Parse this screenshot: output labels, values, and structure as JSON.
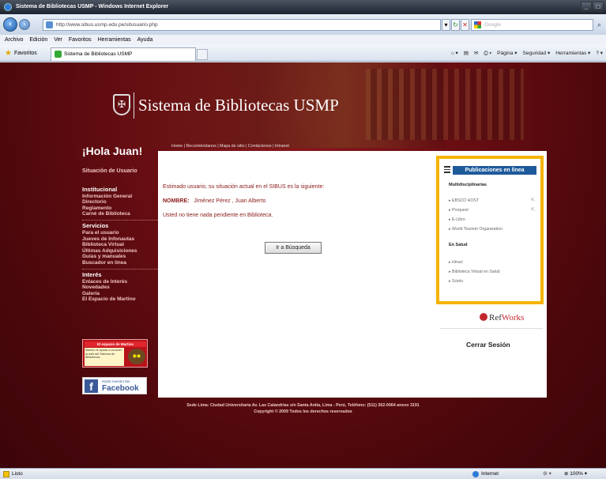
{
  "browser": {
    "window_title": "Sistema de Bibliotecas USMP - Windows Internet Explorer",
    "address": "http://www.sibus.usmp.edu.pe/situsuario.php",
    "search_placeholder": "Google",
    "menu": [
      "Archivo",
      "Edición",
      "Ver",
      "Favoritos",
      "Herramientas",
      "Ayuda"
    ],
    "favorites_label": "Favoritos",
    "tab_title": "Sistema de Bibliotecas USMP",
    "commands": [
      "Página",
      "Seguridad",
      "Herramientas"
    ],
    "status_text": "Listo",
    "zone": "Internet",
    "zoom": "100%"
  },
  "site": {
    "brand": "Sistema de Bibliotecas USMP",
    "greeting": "¡Hola Juan!",
    "top_nav": "Home  |  Recomiéndanos  |  Mapa de sitio  |  Contáctenos  |  Intranet"
  },
  "sidebar": {
    "situacion": "Situación de Usuario",
    "institucional": {
      "heading": "Institucional",
      "items": [
        "Información General",
        "Directorio",
        "Reglamento",
        "Carné de Biblioteca"
      ]
    },
    "servicios": {
      "heading": "Servicios",
      "items": [
        "Para el usuario",
        "Jueves de Infonautas",
        "Biblioteca Virtual",
        "Últimas Adquisiciones",
        "Guías y manuales",
        "Buscador en línea"
      ]
    },
    "interes": {
      "heading": "Interés",
      "items": [
        "Enlaces de Interés",
        "Novedades",
        "Galería",
        "El Espacio de Martino"
      ]
    },
    "martino": {
      "title": "El espacio de Martino",
      "body": "Martino te ayuda a conocer la web del Sistema de Bibliotecas"
    },
    "facebook": {
      "tagline": "Hazte nuestro fan",
      "name": "Facebook"
    }
  },
  "main": {
    "message": "Estimado usuario, su situación actual en el SIBUS es la siguiente:",
    "name_label": "NOMBRE:",
    "name_value": "Jiménez Pérez , Juan Alberto",
    "pending": "Usted no tiene nada pendiente en Biblioteca.",
    "button": "Ir a Búsqueda"
  },
  "publications": {
    "heading": "Publicaciones en línea",
    "multi": {
      "heading": "Multidisciplinarias",
      "items": [
        "EBSCO HOST",
        "Proquest",
        "E-Libro",
        "World Tourism Organization"
      ]
    },
    "salud": {
      "heading": "En Salud",
      "items": [
        "Hinari",
        "Biblioteca Virtual en Salud",
        "Scielo"
      ]
    }
  },
  "refworks": {
    "part1": "Ref",
    "part2": "Works"
  },
  "logout": "Cerrar Sesión",
  "footer": {
    "line1": "Sede Lima: Ciudad Universitaria Av. Las Calandrias s/n Santa Anita, Lima - Perú, Teléfono: (511) 362-0064 anexo 3191",
    "line2": "Copyright © 2009 Todos los derechos reservados"
  },
  "colors": {
    "accent": "#f5b400",
    "brand_red": "#6a0e13",
    "pub_header": "#1d5a9a"
  }
}
